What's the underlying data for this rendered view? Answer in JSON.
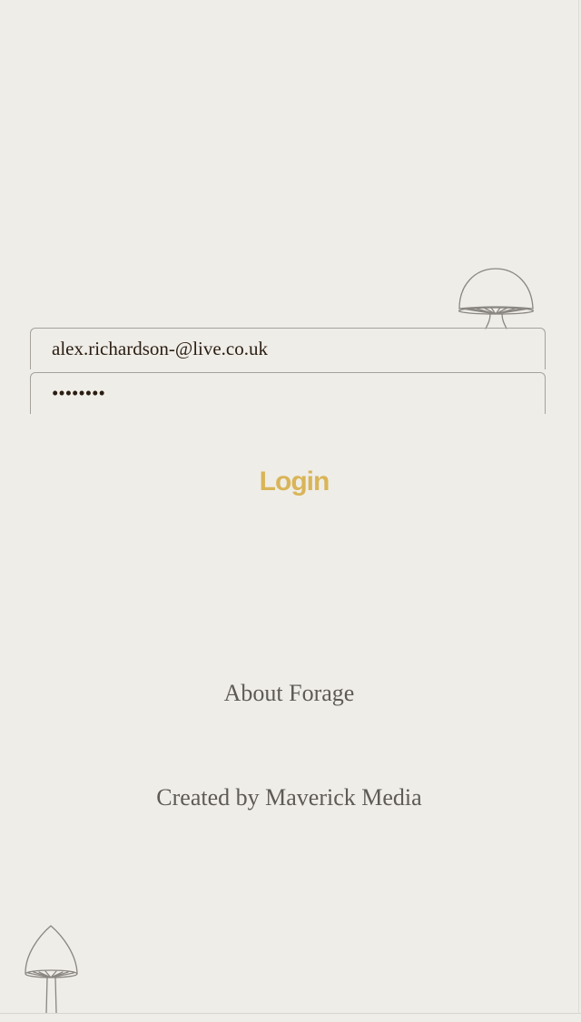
{
  "login_form": {
    "email_value": "alex.richardson-@live.co.uk",
    "password_value": "••••••••",
    "login_label": "Login"
  },
  "footer": {
    "about_label": "About Forage",
    "credit_label": "Created by Maverick Media"
  },
  "colors": {
    "background": "#efede8",
    "accent": "#d9b558",
    "text_muted": "#5e5a56",
    "input_text": "#2b1d12",
    "border": "#a5a29c"
  },
  "icons": {
    "top": "mushroom-icon",
    "bottom": "mushroom-icon"
  }
}
